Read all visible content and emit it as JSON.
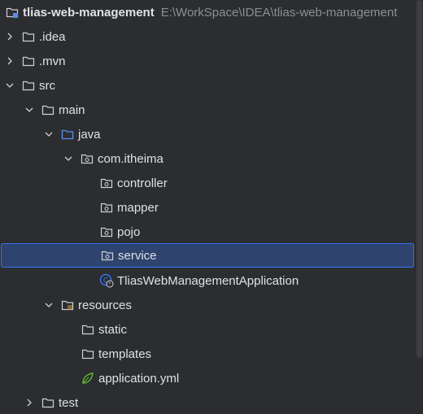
{
  "project": {
    "name": "tlias-web-management",
    "path": "E:\\WorkSpace\\IDEA\\tlias-web-management"
  },
  "nodes": {
    "idea": ".idea",
    "mvn": ".mvn",
    "src": "src",
    "main": "main",
    "java": "java",
    "package": "com.itheima",
    "controller": "controller",
    "mapper": "mapper",
    "pojo": "pojo",
    "service": "service",
    "app_class": "TliasWebManagementApplication",
    "resources": "resources",
    "static": "static",
    "templates": "templates",
    "app_yml": "application.yml",
    "test": "test"
  },
  "selected": "service",
  "colors": {
    "background": "#2b2d30",
    "selection": "#2e436e",
    "selection_border": "#3574f0",
    "text": "#dfe1e5",
    "muted": "#8c8f94",
    "java_folder": "#5b8def",
    "spring_leaf": "#5fb832",
    "app_class_icon": "#3574f0"
  },
  "icons": {
    "collapsed": "chevron-right-icon",
    "expanded": "chevron-down-icon",
    "folder": "folder-icon",
    "package": "package-icon",
    "java_source": "source-folder-icon",
    "resources": "resources-folder-icon",
    "spring_boot_class": "spring-boot-class-icon",
    "yaml": "spring-yaml-icon"
  }
}
